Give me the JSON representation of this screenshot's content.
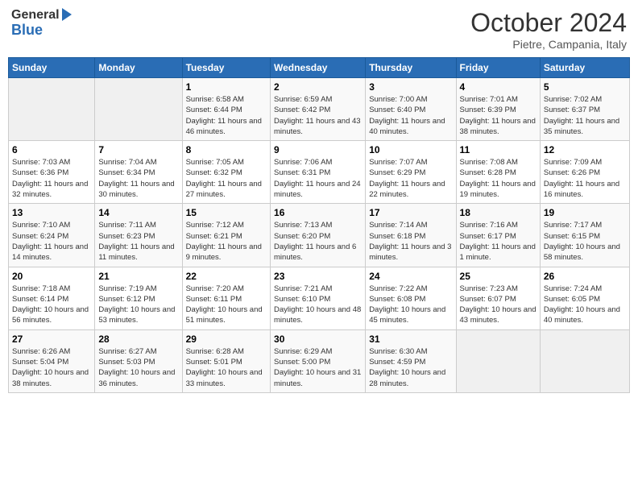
{
  "header": {
    "logo_general": "General",
    "logo_blue": "Blue",
    "month_title": "October 2024",
    "location": "Pietre, Campania, Italy"
  },
  "weekdays": [
    "Sunday",
    "Monday",
    "Tuesday",
    "Wednesday",
    "Thursday",
    "Friday",
    "Saturday"
  ],
  "weeks": [
    [
      {
        "day": "",
        "sunrise": "",
        "sunset": "",
        "daylight": ""
      },
      {
        "day": "",
        "sunrise": "",
        "sunset": "",
        "daylight": ""
      },
      {
        "day": "1",
        "sunrise": "Sunrise: 6:58 AM",
        "sunset": "Sunset: 6:44 PM",
        "daylight": "Daylight: 11 hours and 46 minutes."
      },
      {
        "day": "2",
        "sunrise": "Sunrise: 6:59 AM",
        "sunset": "Sunset: 6:42 PM",
        "daylight": "Daylight: 11 hours and 43 minutes."
      },
      {
        "day": "3",
        "sunrise": "Sunrise: 7:00 AM",
        "sunset": "Sunset: 6:40 PM",
        "daylight": "Daylight: 11 hours and 40 minutes."
      },
      {
        "day": "4",
        "sunrise": "Sunrise: 7:01 AM",
        "sunset": "Sunset: 6:39 PM",
        "daylight": "Daylight: 11 hours and 38 minutes."
      },
      {
        "day": "5",
        "sunrise": "Sunrise: 7:02 AM",
        "sunset": "Sunset: 6:37 PM",
        "daylight": "Daylight: 11 hours and 35 minutes."
      }
    ],
    [
      {
        "day": "6",
        "sunrise": "Sunrise: 7:03 AM",
        "sunset": "Sunset: 6:36 PM",
        "daylight": "Daylight: 11 hours and 32 minutes."
      },
      {
        "day": "7",
        "sunrise": "Sunrise: 7:04 AM",
        "sunset": "Sunset: 6:34 PM",
        "daylight": "Daylight: 11 hours and 30 minutes."
      },
      {
        "day": "8",
        "sunrise": "Sunrise: 7:05 AM",
        "sunset": "Sunset: 6:32 PM",
        "daylight": "Daylight: 11 hours and 27 minutes."
      },
      {
        "day": "9",
        "sunrise": "Sunrise: 7:06 AM",
        "sunset": "Sunset: 6:31 PM",
        "daylight": "Daylight: 11 hours and 24 minutes."
      },
      {
        "day": "10",
        "sunrise": "Sunrise: 7:07 AM",
        "sunset": "Sunset: 6:29 PM",
        "daylight": "Daylight: 11 hours and 22 minutes."
      },
      {
        "day": "11",
        "sunrise": "Sunrise: 7:08 AM",
        "sunset": "Sunset: 6:28 PM",
        "daylight": "Daylight: 11 hours and 19 minutes."
      },
      {
        "day": "12",
        "sunrise": "Sunrise: 7:09 AM",
        "sunset": "Sunset: 6:26 PM",
        "daylight": "Daylight: 11 hours and 16 minutes."
      }
    ],
    [
      {
        "day": "13",
        "sunrise": "Sunrise: 7:10 AM",
        "sunset": "Sunset: 6:24 PM",
        "daylight": "Daylight: 11 hours and 14 minutes."
      },
      {
        "day": "14",
        "sunrise": "Sunrise: 7:11 AM",
        "sunset": "Sunset: 6:23 PM",
        "daylight": "Daylight: 11 hours and 11 minutes."
      },
      {
        "day": "15",
        "sunrise": "Sunrise: 7:12 AM",
        "sunset": "Sunset: 6:21 PM",
        "daylight": "Daylight: 11 hours and 9 minutes."
      },
      {
        "day": "16",
        "sunrise": "Sunrise: 7:13 AM",
        "sunset": "Sunset: 6:20 PM",
        "daylight": "Daylight: 11 hours and 6 minutes."
      },
      {
        "day": "17",
        "sunrise": "Sunrise: 7:14 AM",
        "sunset": "Sunset: 6:18 PM",
        "daylight": "Daylight: 11 hours and 3 minutes."
      },
      {
        "day": "18",
        "sunrise": "Sunrise: 7:16 AM",
        "sunset": "Sunset: 6:17 PM",
        "daylight": "Daylight: 11 hours and 1 minute."
      },
      {
        "day": "19",
        "sunrise": "Sunrise: 7:17 AM",
        "sunset": "Sunset: 6:15 PM",
        "daylight": "Daylight: 10 hours and 58 minutes."
      }
    ],
    [
      {
        "day": "20",
        "sunrise": "Sunrise: 7:18 AM",
        "sunset": "Sunset: 6:14 PM",
        "daylight": "Daylight: 10 hours and 56 minutes."
      },
      {
        "day": "21",
        "sunrise": "Sunrise: 7:19 AM",
        "sunset": "Sunset: 6:12 PM",
        "daylight": "Daylight: 10 hours and 53 minutes."
      },
      {
        "day": "22",
        "sunrise": "Sunrise: 7:20 AM",
        "sunset": "Sunset: 6:11 PM",
        "daylight": "Daylight: 10 hours and 51 minutes."
      },
      {
        "day": "23",
        "sunrise": "Sunrise: 7:21 AM",
        "sunset": "Sunset: 6:10 PM",
        "daylight": "Daylight: 10 hours and 48 minutes."
      },
      {
        "day": "24",
        "sunrise": "Sunrise: 7:22 AM",
        "sunset": "Sunset: 6:08 PM",
        "daylight": "Daylight: 10 hours and 45 minutes."
      },
      {
        "day": "25",
        "sunrise": "Sunrise: 7:23 AM",
        "sunset": "Sunset: 6:07 PM",
        "daylight": "Daylight: 10 hours and 43 minutes."
      },
      {
        "day": "26",
        "sunrise": "Sunrise: 7:24 AM",
        "sunset": "Sunset: 6:05 PM",
        "daylight": "Daylight: 10 hours and 40 minutes."
      }
    ],
    [
      {
        "day": "27",
        "sunrise": "Sunrise: 6:26 AM",
        "sunset": "Sunset: 5:04 PM",
        "daylight": "Daylight: 10 hours and 38 minutes."
      },
      {
        "day": "28",
        "sunrise": "Sunrise: 6:27 AM",
        "sunset": "Sunset: 5:03 PM",
        "daylight": "Daylight: 10 hours and 36 minutes."
      },
      {
        "day": "29",
        "sunrise": "Sunrise: 6:28 AM",
        "sunset": "Sunset: 5:01 PM",
        "daylight": "Daylight: 10 hours and 33 minutes."
      },
      {
        "day": "30",
        "sunrise": "Sunrise: 6:29 AM",
        "sunset": "Sunset: 5:00 PM",
        "daylight": "Daylight: 10 hours and 31 minutes."
      },
      {
        "day": "31",
        "sunrise": "Sunrise: 6:30 AM",
        "sunset": "Sunset: 4:59 PM",
        "daylight": "Daylight: 10 hours and 28 minutes."
      },
      {
        "day": "",
        "sunrise": "",
        "sunset": "",
        "daylight": ""
      },
      {
        "day": "",
        "sunrise": "",
        "sunset": "",
        "daylight": ""
      }
    ]
  ]
}
